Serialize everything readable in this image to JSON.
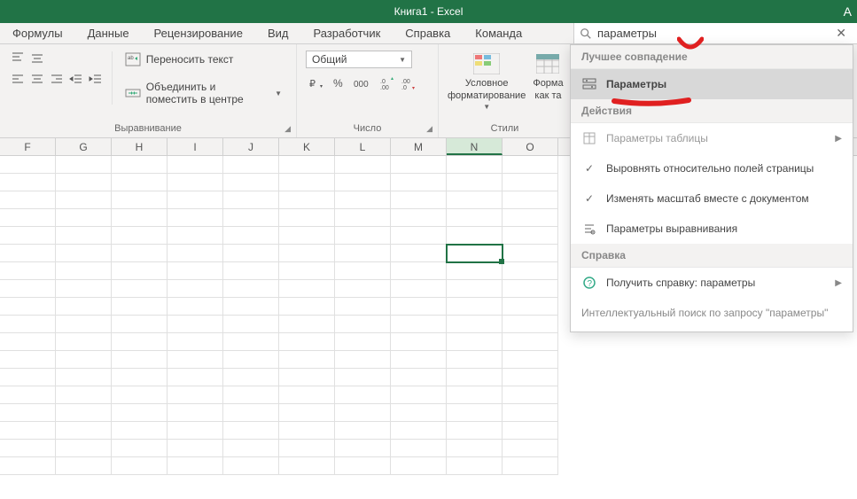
{
  "titlebar": {
    "title": "Книга1  -  Excel",
    "corner": "A"
  },
  "tabs": [
    "Формулы",
    "Данные",
    "Рецензирование",
    "Вид",
    "Разработчик",
    "Справка",
    "Команда"
  ],
  "search": {
    "value": "параметры",
    "close": "✕"
  },
  "ribbon": {
    "alignment": {
      "wrap": "Переносить текст",
      "merge": "Объединить и поместить в центре",
      "label": "Выравнивание"
    },
    "number": {
      "format": "Общий",
      "label": "Число"
    },
    "styles": {
      "conditional_l1": "Условное",
      "conditional_l2": "форматирование",
      "format_l1": "Форма",
      "format_l2": "как та",
      "label": "Стили"
    }
  },
  "columns": [
    "F",
    "G",
    "H",
    "I",
    "J",
    "K",
    "L",
    "M",
    "N",
    "O"
  ],
  "active_col_index": 8,
  "row_count": 18,
  "active_row_index": 5,
  "panel": {
    "best_match": "Лучшее совпадение",
    "params": "Параметры",
    "actions": "Действия",
    "items": [
      {
        "icon": "table",
        "label": "Параметры таблицы",
        "dim": true,
        "arrow": true
      },
      {
        "icon": "check",
        "label": "Выровнять относительно полей страницы"
      },
      {
        "icon": "check",
        "label": "Изменять масштаб вместе с документом"
      },
      {
        "icon": "align",
        "label": "Параметры выравнивания"
      }
    ],
    "help": "Справка",
    "help_item": {
      "label": "Получить справку: параметры",
      "arrow": true
    },
    "footer": "Интеллектуальный поиск по запросу \"параметры\""
  }
}
